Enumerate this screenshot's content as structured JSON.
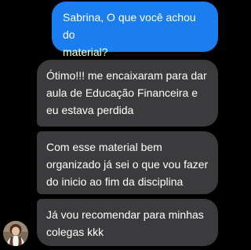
{
  "messages": [
    {
      "sender": "outgoing",
      "text": "Sabrina, O que você achou do\nmaterial?"
    },
    {
      "sender": "incoming",
      "text": "Ótimo!!! me encaixaram para dar\naula de Educação Financeira e\neu estava perdida"
    },
    {
      "sender": "incoming",
      "text": "Com esse material bem\norganizado já sei o que vou fazer\ndo inicio ao fim da disciplina"
    },
    {
      "sender": "incoming",
      "text": "Já vou recomendar para minhas\ncolegas kkk"
    }
  ],
  "colors": {
    "background": "#000000",
    "outgoing_bubble": "#1a7ef0",
    "incoming_bubble": "#3b3b3d",
    "text": "#ffffff"
  },
  "avatar": {
    "icon": "user-avatar-icon"
  }
}
